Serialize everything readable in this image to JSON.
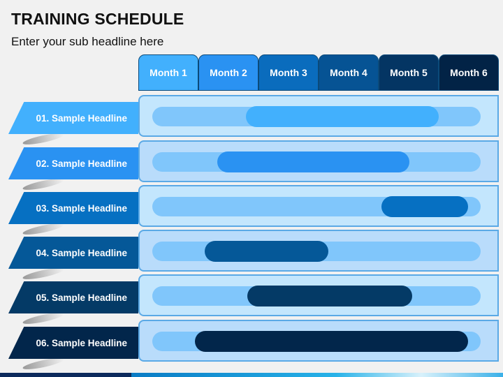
{
  "title": "TRAINING SCHEDULE",
  "subtitle": "Enter your sub headline here",
  "months": [
    {
      "label": "Month 1",
      "color": "#42b0fd"
    },
    {
      "label": "Month 2",
      "color": "#2a92f2"
    },
    {
      "label": "Month 3",
      "color": "#0a6cbd"
    },
    {
      "label": "Month 4",
      "color": "#065394"
    },
    {
      "label": "Month 5",
      "color": "#043563"
    },
    {
      "label": "Month 6",
      "color": "#022346"
    }
  ],
  "rows": [
    {
      "label": "01. Sample Headline",
      "color": "#42b0fd",
      "panel_bg": "#c3e6fd",
      "start": 0.285,
      "end": 0.872
    },
    {
      "label": "02. Sample Headline",
      "color": "#2a92f2",
      "panel_bg": "#b9dcfb",
      "start": 0.198,
      "end": 0.783
    },
    {
      "label": "03. Sample Headline",
      "color": "#0670c2",
      "panel_bg": "#c3e6fd",
      "start": 0.698,
      "end": 0.962
    },
    {
      "label": "04. Sample Headline",
      "color": "#055898",
      "panel_bg": "#b9dcfb",
      "start": 0.16,
      "end": 0.536
    },
    {
      "label": "05. Sample Headline",
      "color": "#043a66",
      "panel_bg": "#c3e6fd",
      "start": 0.289,
      "end": 0.791
    },
    {
      "label": "06. Sample Headline",
      "color": "#02264b",
      "panel_bg": "#b9dcfb",
      "start": 0.13,
      "end": 0.962
    }
  ]
}
